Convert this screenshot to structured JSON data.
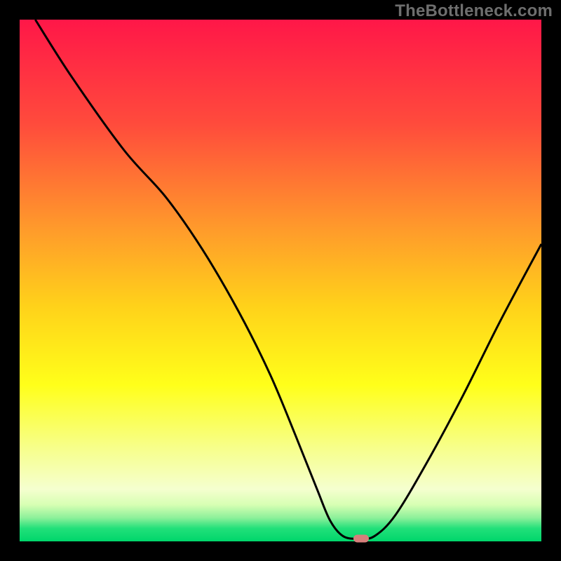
{
  "watermark": "TheBottleneck.com",
  "colors": {
    "frame_bg": "#000000",
    "watermark": "#6e6e6e",
    "curve": "#000000",
    "marker": "#d67f7b",
    "gradient_stops": [
      {
        "offset": 0.0,
        "color": "#ff1748"
      },
      {
        "offset": 0.2,
        "color": "#ff4b3c"
      },
      {
        "offset": 0.4,
        "color": "#ff9a2b"
      },
      {
        "offset": 0.55,
        "color": "#ffd21a"
      },
      {
        "offset": 0.7,
        "color": "#ffff1a"
      },
      {
        "offset": 0.82,
        "color": "#f7ff8a"
      },
      {
        "offset": 0.9,
        "color": "#f5ffcf"
      },
      {
        "offset": 0.93,
        "color": "#d7ffb3"
      },
      {
        "offset": 0.955,
        "color": "#8cf09a"
      },
      {
        "offset": 0.975,
        "color": "#22e07a"
      },
      {
        "offset": 1.0,
        "color": "#00d66b"
      }
    ]
  },
  "chart_data": {
    "type": "line",
    "title": "",
    "xlabel": "",
    "ylabel": "",
    "xlim": [
      0,
      100
    ],
    "ylim": [
      0,
      100
    ],
    "grid": false,
    "series": [
      {
        "name": "bottleneck-curve",
        "x": [
          3,
          10,
          20,
          28,
          35,
          42,
          48,
          53,
          57,
          59.5,
          62,
          65,
          68,
          72,
          78,
          85,
          92,
          100
        ],
        "y": [
          100,
          89,
          75,
          66,
          56,
          44,
          32,
          20,
          10,
          4,
          1,
          0.5,
          1,
          5,
          15,
          28,
          42,
          57
        ]
      }
    ],
    "annotations": [
      {
        "name": "optimal-marker",
        "shape": "pill",
        "x": 65.5,
        "y": 0.6,
        "color": "#d67f7b"
      }
    ]
  }
}
